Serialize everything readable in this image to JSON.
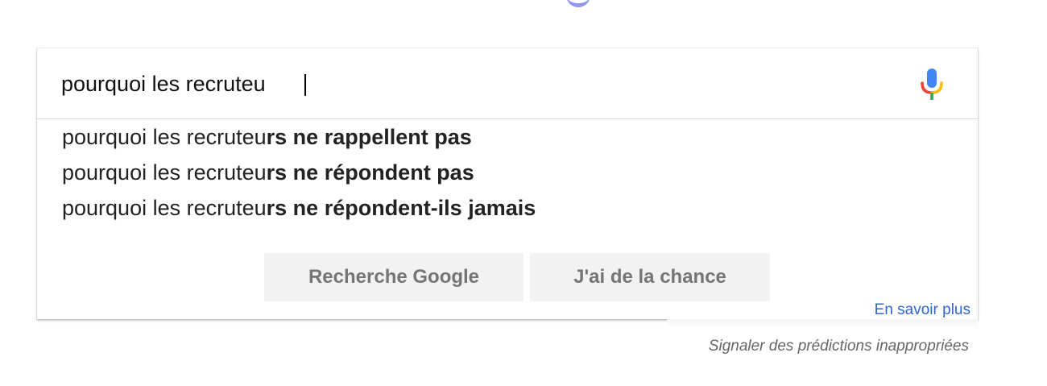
{
  "search": {
    "query": "pourquoi les recruteu",
    "placeholder": ""
  },
  "suggestions": [
    {
      "typed": "pourquoi les recruteu",
      "completion": "rs ne rappellent pas"
    },
    {
      "typed": "pourquoi les recruteu",
      "completion": "rs ne répondent pas"
    },
    {
      "typed": "pourquoi les recruteu",
      "completion": "rs ne répondent-ils jamais"
    }
  ],
  "buttons": {
    "search_label": "Recherche Google",
    "lucky_label": "J'ai de la chance"
  },
  "links": {
    "learn_more": "En savoir plus",
    "report": "Signaler des prédictions inappropriées"
  },
  "icons": {
    "mic": "microphone-icon"
  },
  "colors": {
    "link_blue": "#3366cc",
    "mic_blue": "#4285f4",
    "mic_red": "#ea4335",
    "mic_yellow": "#fbbc05",
    "mic_green": "#34a853",
    "button_bg": "#f2f2f2",
    "button_text": "#757575"
  }
}
